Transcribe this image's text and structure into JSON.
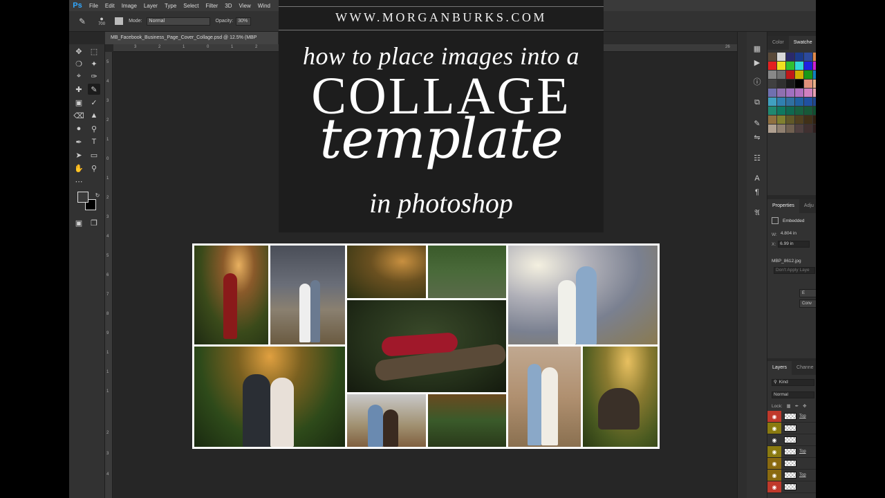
{
  "app": {
    "logo": "Ps",
    "menu": [
      "File",
      "Edit",
      "Image",
      "Layer",
      "Type",
      "Select",
      "Filter",
      "3D",
      "View",
      "Wind"
    ]
  },
  "options": {
    "brush_size": "700",
    "mode_label": "Mode:",
    "mode_value": "Normal",
    "opacity_label": "Opacity:",
    "opacity_value": "30%"
  },
  "document": {
    "tab_title": "MB_Facebook_Business_Page_Cover_Collage.psd @ 12.5% (MBP"
  },
  "rulers": {
    "top": [
      "3",
      "2",
      "1",
      "0",
      "1",
      "2",
      "3",
      "26"
    ],
    "left": [
      "5",
      "4",
      "3",
      "2",
      "1",
      "0",
      "1",
      "2",
      "3",
      "4",
      "5",
      "6",
      "7",
      "8",
      "9",
      "1",
      "1",
      "1",
      "2",
      "3",
      "4"
    ]
  },
  "panels": {
    "color_tab": "Color",
    "swatches_tab": "Swatche",
    "swatches": [
      "#5a4a3a",
      "#d8d8d8",
      "#2a2a6a",
      "#1b3b8a",
      "#2c4a9c",
      "#e08a4a",
      "#e32020",
      "#f0e020",
      "#30c030",
      "#30d8d8",
      "#2020e0",
      "#d020d0",
      "#888888",
      "#707070",
      "#c01818",
      "#d0b000",
      "#189818",
      "#1080c0",
      "#404040",
      "#303030",
      "#1a1a1a",
      "#000000",
      "#e0907a",
      "#e8b088",
      "#7070b0",
      "#9070b0",
      "#a070c0",
      "#b070c0",
      "#d080c0",
      "#e8a0b0",
      "#40a0c0",
      "#3080b0",
      "#3070a0",
      "#2060a0",
      "#2050a0",
      "#204890",
      "#208870",
      "#107860",
      "#106850",
      "#186040",
      "#185838",
      "#105030",
      "#907040",
      "#808030",
      "#605828",
      "#504020",
      "#403018",
      "#302010",
      "#b0a090",
      "#908070",
      "#706050",
      "#504040",
      "#403030",
      "#302020"
    ],
    "properties_tab": "Properties",
    "adjustments_tab": "Adju",
    "embedded_label": "Embedded",
    "w_label": "W:",
    "w_value": "4.804 in",
    "x_label": "X:",
    "x_value": "6.99 in",
    "file_name": "MBP_8612.jpg",
    "dont_apply": "Don't Apply Laye",
    "btn_edit": "E",
    "btn_conv": "Conv",
    "layers_tab": "Layers",
    "channels_tab": "Channe",
    "kind_label": "Kind",
    "blend_label": "Normal",
    "lock_label": "Lock:",
    "layer_rows": [
      {
        "name": "Top",
        "eye_color": "#c0392b"
      },
      {
        "name": "",
        "eye_color": "#8a7a10"
      },
      {
        "name": "",
        "eye_color": "#323232"
      },
      {
        "name": "Top",
        "eye_color": "#8a7a10"
      },
      {
        "name": "",
        "eye_color": "#8a6a10"
      },
      {
        "name": "Top",
        "eye_color": "#8a6a10"
      },
      {
        "name": "",
        "eye_color": "#c0392b"
      }
    ]
  },
  "title_card": {
    "url": "WWW.MORGANBURKS.COM",
    "line1": "how to place images into a",
    "line2": "COLLAGE",
    "line3": "template",
    "line4": "in photoshop"
  }
}
